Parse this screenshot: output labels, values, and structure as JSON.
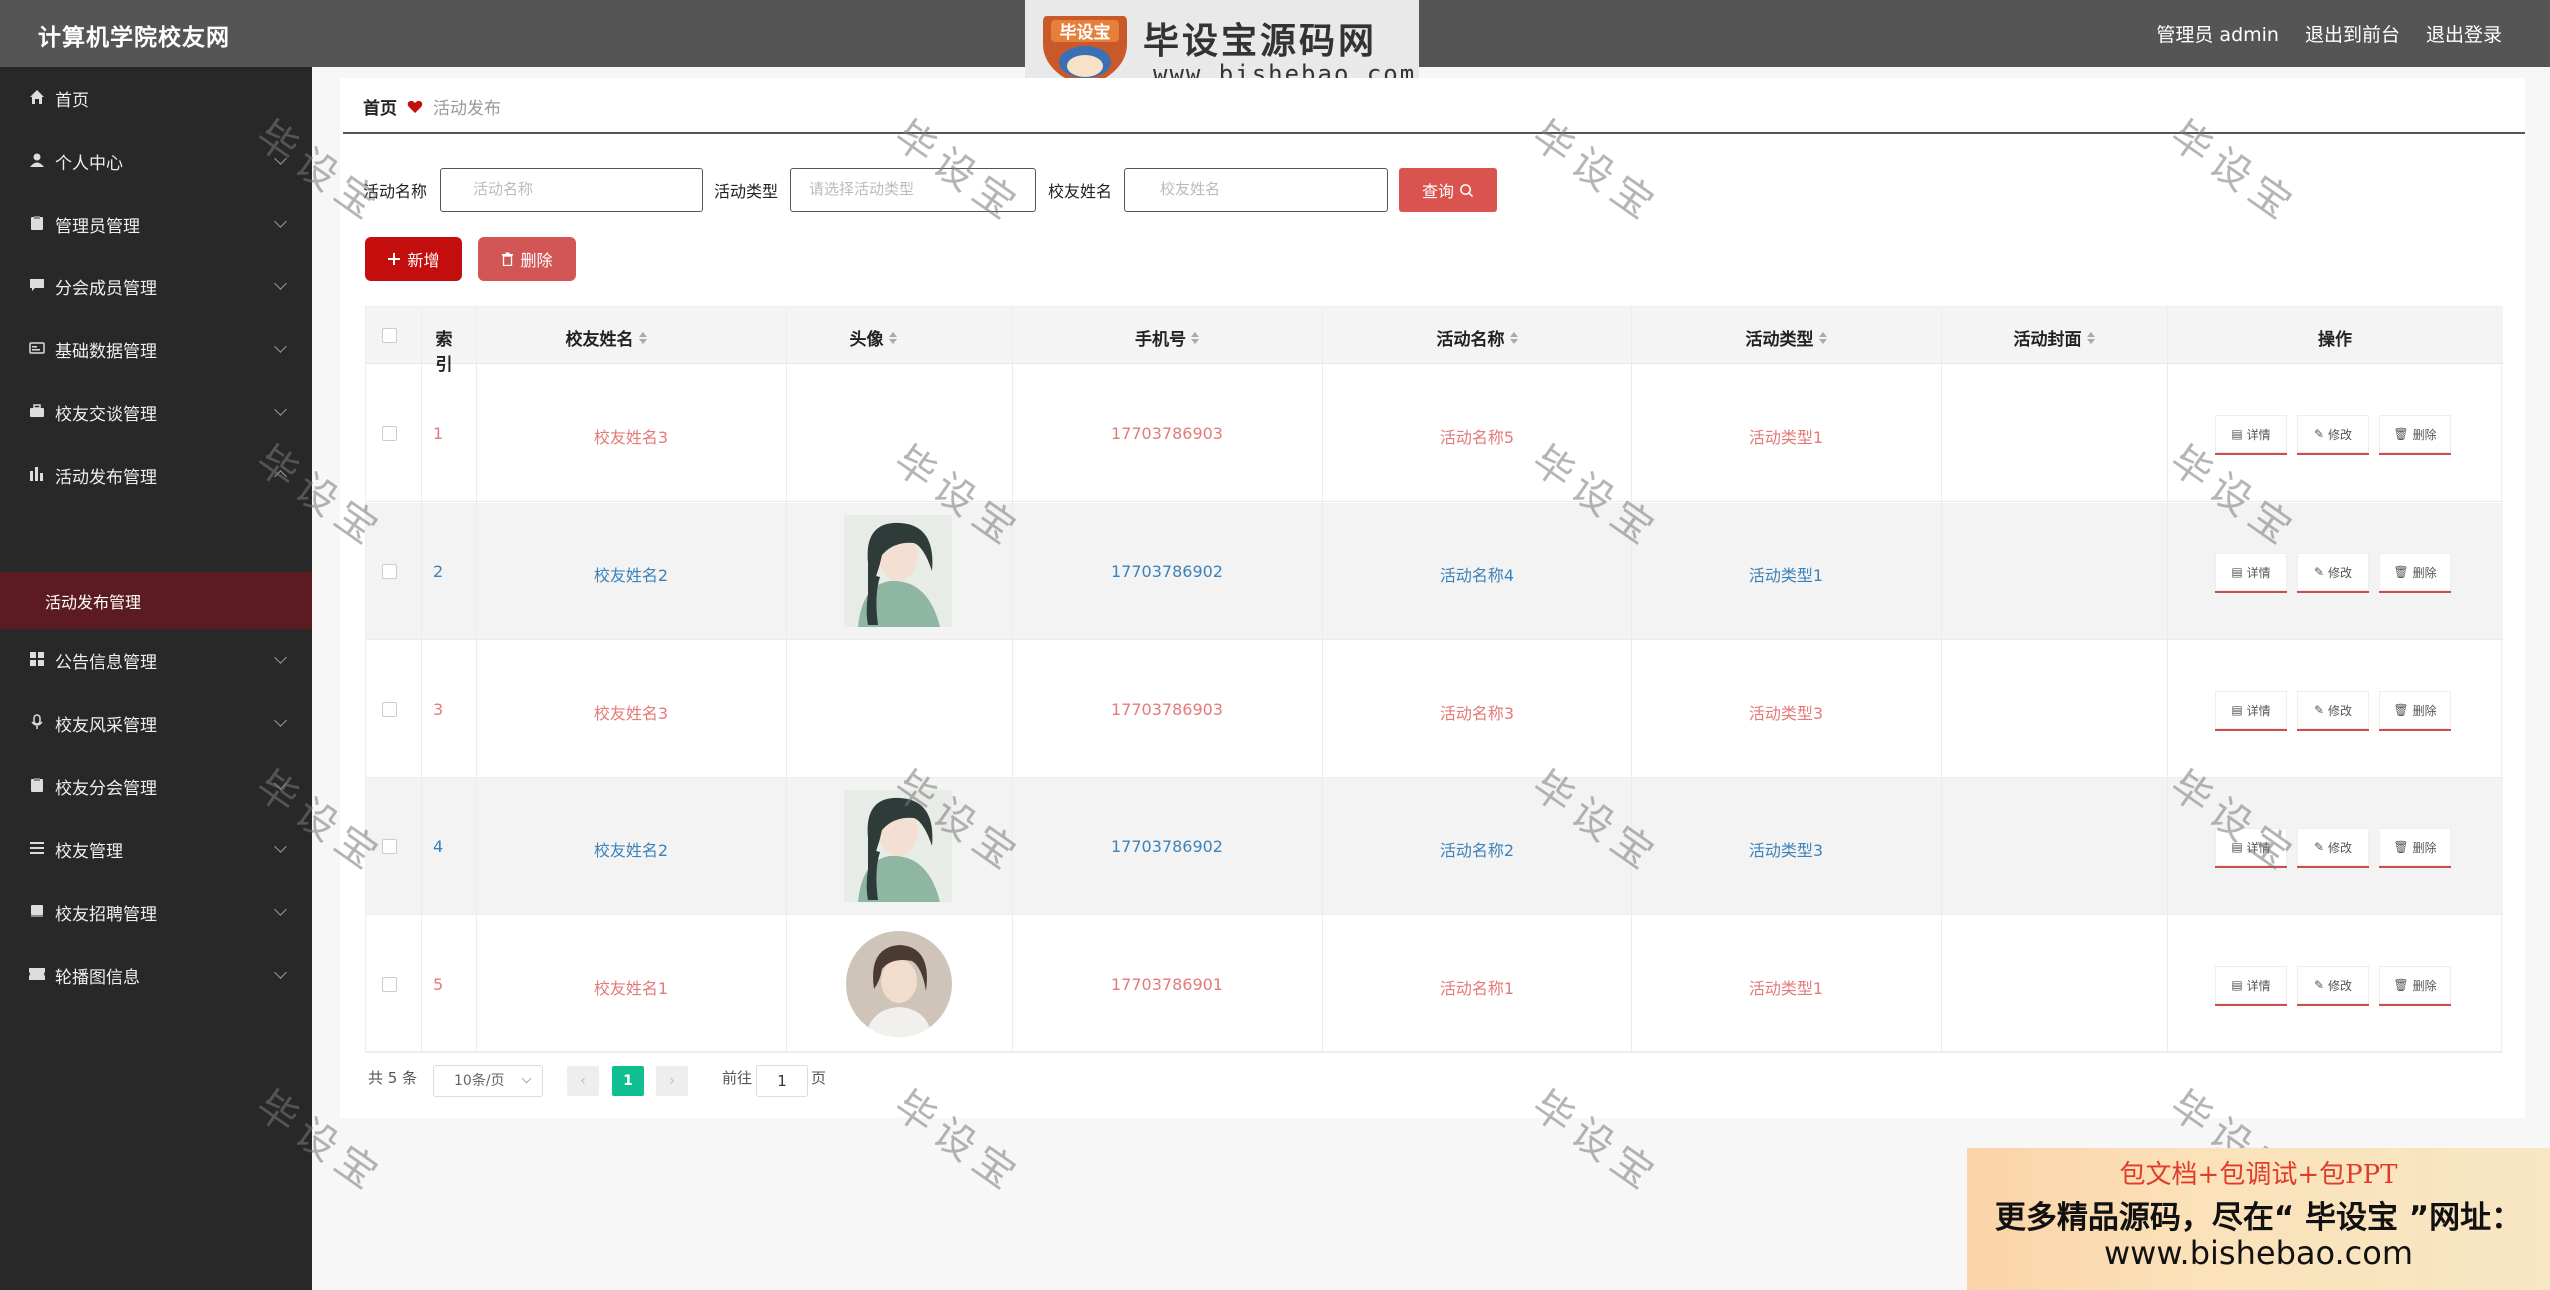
{
  "header": {
    "app_title": "计算机学院校友网",
    "user_label": "管理员 admin",
    "front_link": "退出到前台",
    "logout_link": "退出登录"
  },
  "site_logo": {
    "main": "毕设宝源码网",
    "url": "www.bishebao.com",
    "badge": "毕设宝"
  },
  "sidebar": {
    "items": [
      {
        "label": "首页",
        "icon": "home-icon",
        "chevron": false
      },
      {
        "label": "个人中心",
        "icon": "user-icon",
        "chevron": true
      },
      {
        "label": "管理员管理",
        "icon": "clipboard-icon",
        "chevron": true
      },
      {
        "label": "分会成员管理",
        "icon": "chat-icon",
        "chevron": true
      },
      {
        "label": "基础数据管理",
        "icon": "card-icon",
        "chevron": true
      },
      {
        "label": "校友交谈管理",
        "icon": "briefcase-icon",
        "chevron": true
      },
      {
        "label": "活动发布管理",
        "icon": "chart-icon",
        "chevron": true,
        "expanded": true
      },
      {
        "label": "公告信息管理",
        "icon": "grid-icon",
        "chevron": true
      },
      {
        "label": "校友风采管理",
        "icon": "mic-icon",
        "chevron": true
      },
      {
        "label": "校友分会管理",
        "icon": "clipboard-icon",
        "chevron": true
      },
      {
        "label": "校友管理",
        "icon": "list-icon",
        "chevron": true
      },
      {
        "label": "校友招聘管理",
        "icon": "book-icon",
        "chevron": true
      },
      {
        "label": "轮播图信息",
        "icon": "ticket-icon",
        "chevron": true
      }
    ],
    "active_sub": "活动发布管理"
  },
  "breadcrumb": {
    "home": "首页",
    "current": "活动发布"
  },
  "filters": {
    "activity_name_label": "活动名称",
    "activity_name_placeholder": "活动名称",
    "activity_type_label": "活动类型",
    "activity_type_placeholder": "请选择活动类型",
    "alumni_name_label": "校友姓名",
    "alumni_name_placeholder": "校友姓名",
    "query_label": "查询"
  },
  "actions": {
    "add_label": "新增",
    "delete_label": "删除"
  },
  "table": {
    "headers": [
      "索引",
      "校友姓名",
      "头像",
      "手机号",
      "活动名称",
      "活动类型",
      "活动封面",
      "操作"
    ],
    "rows": [
      {
        "index": "1",
        "name": "校友姓名3",
        "avatar": "",
        "phone": "17703786903",
        "activity": "活动名称5",
        "type": "活动类型1",
        "color": "#e47a7a"
      },
      {
        "index": "2",
        "name": "校友姓名2",
        "avatar": "girl-portrait",
        "phone": "17703786902",
        "activity": "活动名称4",
        "type": "活动类型1",
        "color": "#3d82b8"
      },
      {
        "index": "3",
        "name": "校友姓名3",
        "avatar": "",
        "phone": "17703786903",
        "activity": "活动名称3",
        "type": "活动类型3",
        "color": "#e47a7a"
      },
      {
        "index": "4",
        "name": "校友姓名2",
        "avatar": "girl-portrait",
        "phone": "17703786902",
        "activity": "活动名称2",
        "type": "活动类型3",
        "color": "#3d82b8"
      },
      {
        "index": "5",
        "name": "校友姓名1",
        "avatar": "round-portrait",
        "phone": "17703786901",
        "activity": "活动名称1",
        "type": "活动类型1",
        "color": "#e47a7a"
      }
    ],
    "op_labels": {
      "detail": "详情",
      "edit": "修改",
      "delete": "删除"
    }
  },
  "pagination": {
    "total": "共 5 条",
    "page_size": "10条/页",
    "current_page": "1",
    "goto_label": "前往",
    "goto_value": "1",
    "page_suffix": "页"
  },
  "watermark": "毕设宝",
  "promo": {
    "line1": "包文档+包调试+包PPT",
    "line2": "更多精品源码，尽在“ 毕设宝 ”网址：",
    "line3": "www.bishebao.com"
  },
  "colors": {
    "accent_red": "#c40d0d",
    "query_red": "#d9534f",
    "pager_green": "#0fbf92",
    "sidebar_bg": "#282828",
    "topbar_bg": "#555555"
  }
}
